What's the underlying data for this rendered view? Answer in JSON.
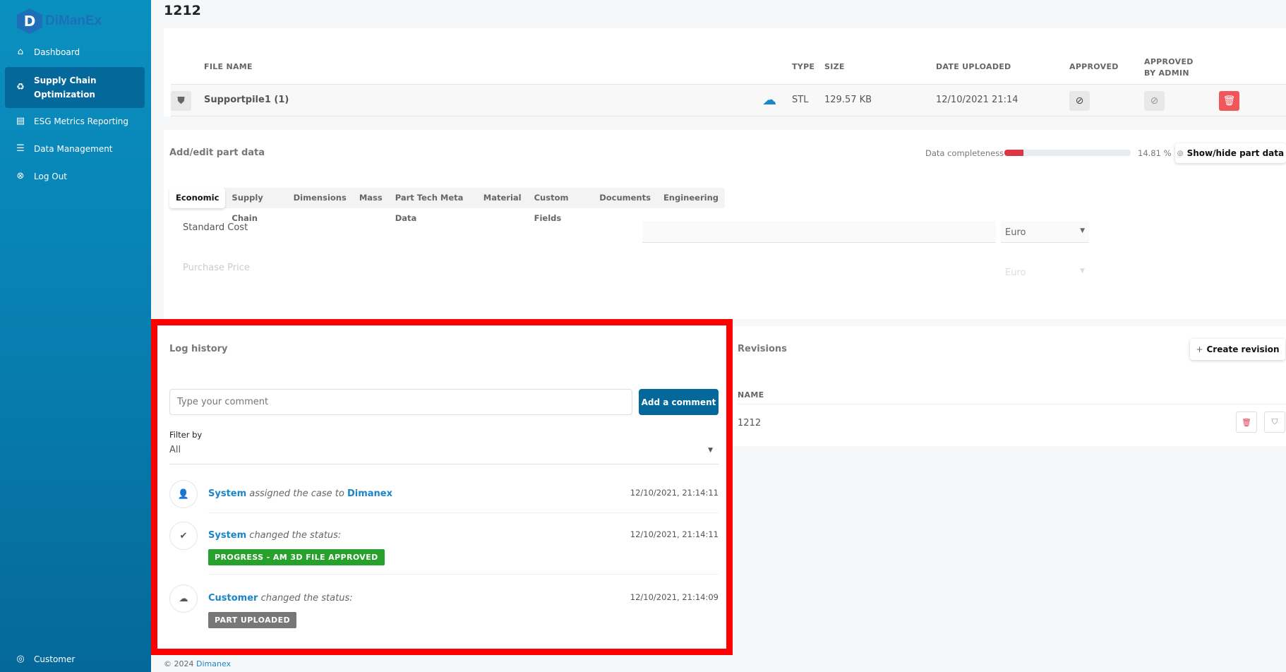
{
  "brand": {
    "name": "DiManEx",
    "logo_letter": "D"
  },
  "sidebar": {
    "items": [
      {
        "label": "Dashboard",
        "icon": "home-icon"
      },
      {
        "label": "Supply Chain Optimization",
        "icon": "cycle-icon",
        "active": true
      },
      {
        "label": "ESG Metrics Reporting",
        "icon": "clipboard-icon"
      },
      {
        "label": "Data Management",
        "icon": "database-icon"
      },
      {
        "label": "Log Out",
        "icon": "close-circle-icon"
      }
    ],
    "user": "Customer"
  },
  "page": {
    "title": "1212"
  },
  "files": {
    "headers": {
      "file_name": "FILE NAME",
      "type": "TYPE",
      "size": "SIZE",
      "date": "DATE UPLOADED",
      "approved": "APPROVED",
      "approved_admin": "APPROVED BY ADMIN"
    },
    "rows": [
      {
        "name": "Supportpile1 (1)",
        "type": "STL",
        "size": "129.57 KB",
        "date": "12/10/2021 21:14"
      }
    ]
  },
  "part": {
    "title": "Add/edit part data",
    "completeness_label": "Data completeness",
    "completeness_pct": 14.81,
    "completeness_text": "14.81 %",
    "completeness_color": "#dc3545",
    "toggle_label": "Show/hide part data",
    "tabs": [
      "Economic",
      "Supply Chain",
      "Dimensions",
      "Mass",
      "Part Tech Meta Data",
      "Material",
      "Custom Fields",
      "Documents",
      "Engineering"
    ],
    "fields": [
      {
        "label": "Standard Cost",
        "value": "",
        "currency": "Euro"
      },
      {
        "label": "Purchase Price",
        "value": "",
        "currency": "Euro"
      }
    ]
  },
  "log": {
    "title": "Log history",
    "comment_placeholder": "Type your comment",
    "add_label": "Add a comment",
    "filter_label": "Filter by",
    "filter_value": "All",
    "entries": [
      {
        "actor": "System",
        "action": "assigned the case to",
        "target": "Dimanex",
        "time": "12/10/2021, 21:14:11",
        "icon": "user-plus-icon"
      },
      {
        "actor": "System",
        "action": "changed the status:",
        "badge": "PROGRESS - AM 3D FILE APPROVED",
        "badge_color": "#28a02c",
        "time": "12/10/2021, 21:14:11",
        "icon": "check-circle-icon"
      },
      {
        "actor": "Customer",
        "action": "changed the status:",
        "badge": "PART UPLOADED",
        "badge_color": "#777777",
        "time": "12/10/2021, 21:14:09",
        "icon": "cloud-upload-icon"
      }
    ]
  },
  "revisions": {
    "title": "Revisions",
    "create_label": "Create revision",
    "name_header": "NAME",
    "rows": [
      {
        "name": "1212"
      }
    ]
  },
  "footer": {
    "copyright": "© 2024",
    "link": "Dimanex"
  },
  "colors": {
    "accent": "#05689a",
    "link": "#1a85c8",
    "danger": "#f0565a",
    "highlight": "#ff0000"
  }
}
